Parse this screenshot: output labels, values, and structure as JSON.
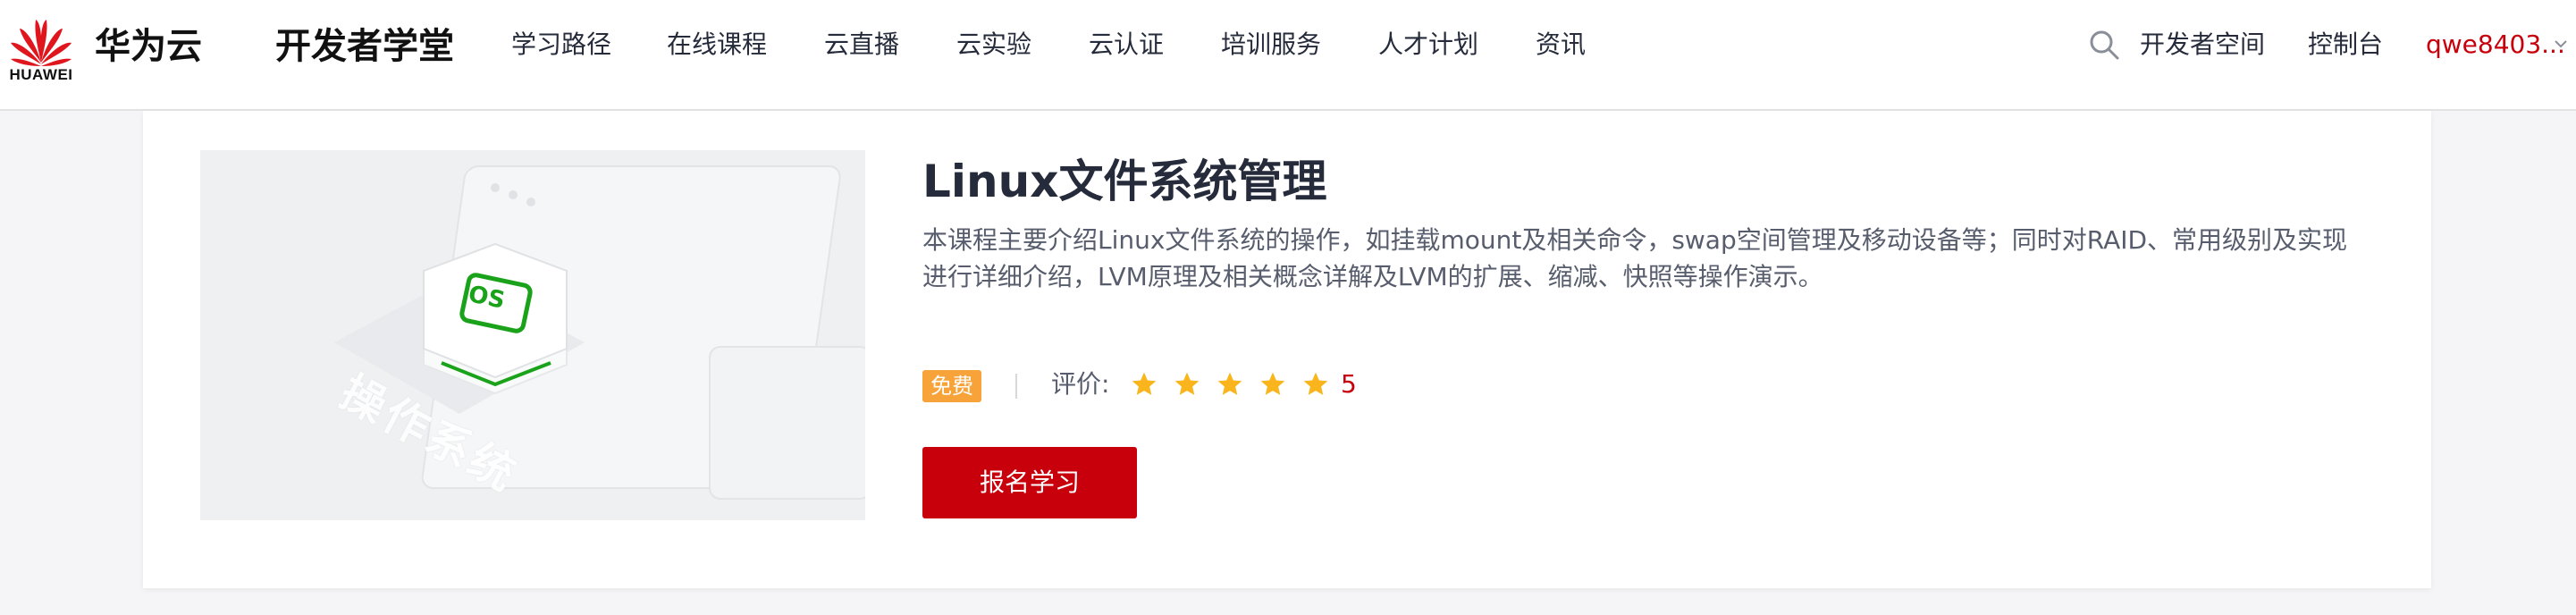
{
  "header": {
    "logo_word": "HUAWEI",
    "brand": "华为云",
    "site_title": "开发者学堂",
    "nav": [
      {
        "label": "学习路径"
      },
      {
        "label": "在线课程"
      },
      {
        "label": "云直播"
      },
      {
        "label": "云实验"
      },
      {
        "label": "云认证"
      },
      {
        "label": "培训服务"
      },
      {
        "label": "人才计划"
      },
      {
        "label": "资讯"
      }
    ],
    "search_icon": "search-icon",
    "developer_space": "开发者空间",
    "console": "控制台",
    "user": "qwe8403..."
  },
  "course": {
    "cover_badge": "OS",
    "cover_caption": "操作系统",
    "title": "Linux文件系统管理",
    "description": "本课程主要介绍Linux文件系统的操作，如挂载mount及相关命令，swap空间管理及移动设备等；同时对RAID、常用级别及实现进行详细介绍，LVM原理及相关概念详解及LVM的扩展、缩减、快照等操作演示。",
    "price_badge": "免费",
    "rating_label": "评价:",
    "rating": 5,
    "rating_text": "5",
    "enroll_label": "报名学习"
  },
  "colors": {
    "brand_red": "#c7000b",
    "badge_orange": "#f7a33a",
    "star_yellow": "#f9b51b",
    "cover_green": "#1aa31a"
  }
}
